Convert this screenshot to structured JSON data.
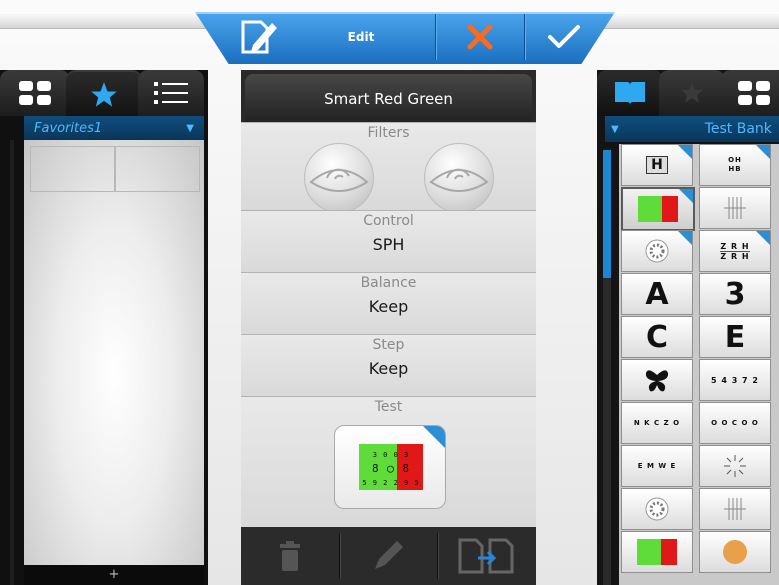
{
  "toolbar": {
    "edit_label": "Edit",
    "icons": [
      "edit-pencil-icon",
      "close-x-icon",
      "checkmark-icon"
    ],
    "colors": {
      "accent": "#2a85d6",
      "cancel": "#ff6a1a",
      "confirm": "#ffffff"
    }
  },
  "left_panel": {
    "tabs": [
      "grid-icon",
      "star-icon",
      "list-icon"
    ],
    "active_tab": "star-icon",
    "favorites_name": "Favorites1",
    "add_label": "+"
  },
  "center_panel": {
    "title": "Smart Red Green",
    "filters_label": "Filters",
    "control_label": "Control",
    "control_value": "SPH",
    "balance_label": "Balance",
    "balance_value": "Keep",
    "step_label": "Step",
    "step_value": "Keep",
    "test_label": "Test",
    "test_chart_rows": [
      "3 0  0 3",
      "8 ◯ 8",
      "5 9 2  2 9 5"
    ],
    "footer_icons": [
      "trash-icon",
      "pencil-icon",
      "transfer-icon"
    ]
  },
  "right_panel": {
    "tabs": [
      "book-icon",
      "star-icon",
      "grid-icon"
    ],
    "bank_name": "Test Bank",
    "tiles": {
      "h_tile": "H",
      "oh_tile": "OH HB",
      "zr_tile_row1": "Z R H",
      "zr_tile_row2": "Z R H",
      "letter_a": "A",
      "letter_3": "3",
      "letter_c": "C",
      "letter_e": "E",
      "numbers_tile": "5 4 3 7 2",
      "nkczo_tile": "N K C Z O",
      "circles_tile": "O O C O O",
      "emwe_tile": "E M W E"
    }
  }
}
